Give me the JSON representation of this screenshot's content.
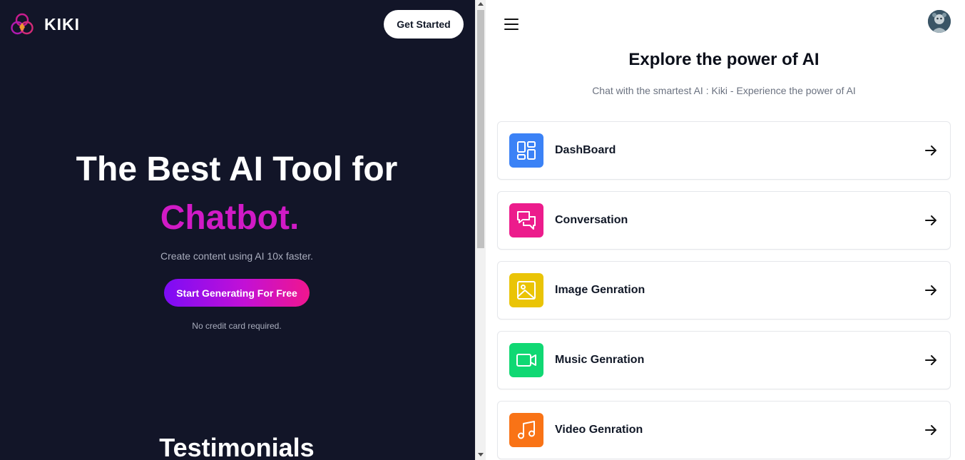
{
  "landing": {
    "brand_name": "KIKI",
    "get_started_label": "Get Started",
    "hero_title": "The Best AI Tool for",
    "hero_highlight": "Chatbot.",
    "hero_subtitle": "Create content using AI 10x faster.",
    "cta_label": "Start Generating For Free",
    "cta_note": "No credit card required.",
    "testimonials_heading": "Testimonials",
    "colors": {
      "background": "#121528",
      "highlight": "#d11ac6",
      "cta_start": "#7c0cf6",
      "cta_end": "#f0168e"
    }
  },
  "app": {
    "menu_icon": "hamburger-menu-icon",
    "avatar": "user-avatar",
    "title": "Explore the power of AI",
    "subtitle": "Chat with the smartest AI : Kiki - Experience the power of AI",
    "tools": [
      {
        "label": "DashBoard",
        "icon": "dashboard-icon",
        "color": "#3b82f6"
      },
      {
        "label": "Conversation",
        "icon": "chat-bubbles-icon",
        "color": "#ec1c8c"
      },
      {
        "label": "Image Genration",
        "icon": "image-icon",
        "color": "#eac406"
      },
      {
        "label": "Music Genration",
        "icon": "video-camera-icon",
        "color": "#10d873"
      },
      {
        "label": "Video Genration",
        "icon": "music-note-icon",
        "color": "#f97316"
      }
    ]
  }
}
